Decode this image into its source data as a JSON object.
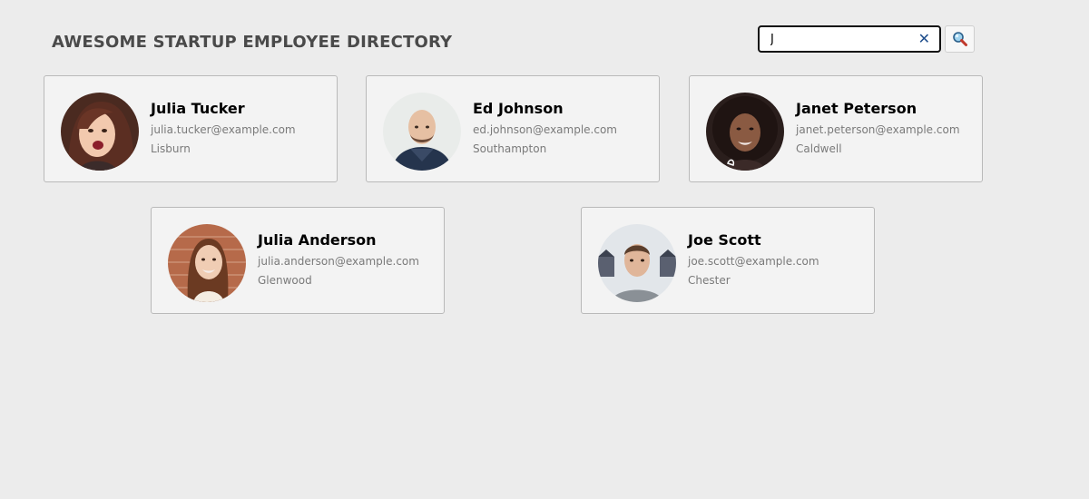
{
  "header": {
    "title": "AWESOME STARTUP EMPLOYEE DIRECTORY"
  },
  "search": {
    "value": "J",
    "clear_icon": "close-icon",
    "button_icon": "magnifier-icon"
  },
  "employees": [
    {
      "name": "Julia Tucker",
      "email": "julia.tucker@example.com",
      "city": "Lisburn",
      "avatar": "woman-brown-hair-portrait"
    },
    {
      "name": "Ed Johnson",
      "email": "ed.johnson@example.com",
      "city": "Southampton",
      "avatar": "bald-man-portrait"
    },
    {
      "name": "Janet Peterson",
      "email": "janet.peterson@example.com",
      "city": "Caldwell",
      "avatar": "woman-curly-hair-portrait"
    },
    {
      "name": "Julia Anderson",
      "email": "julia.anderson@example.com",
      "city": "Glenwood",
      "avatar": "woman-brick-wall-portrait"
    },
    {
      "name": "Joe Scott",
      "email": "joe.scott@example.com",
      "city": "Chester",
      "avatar": "man-short-hair-portrait"
    }
  ]
}
